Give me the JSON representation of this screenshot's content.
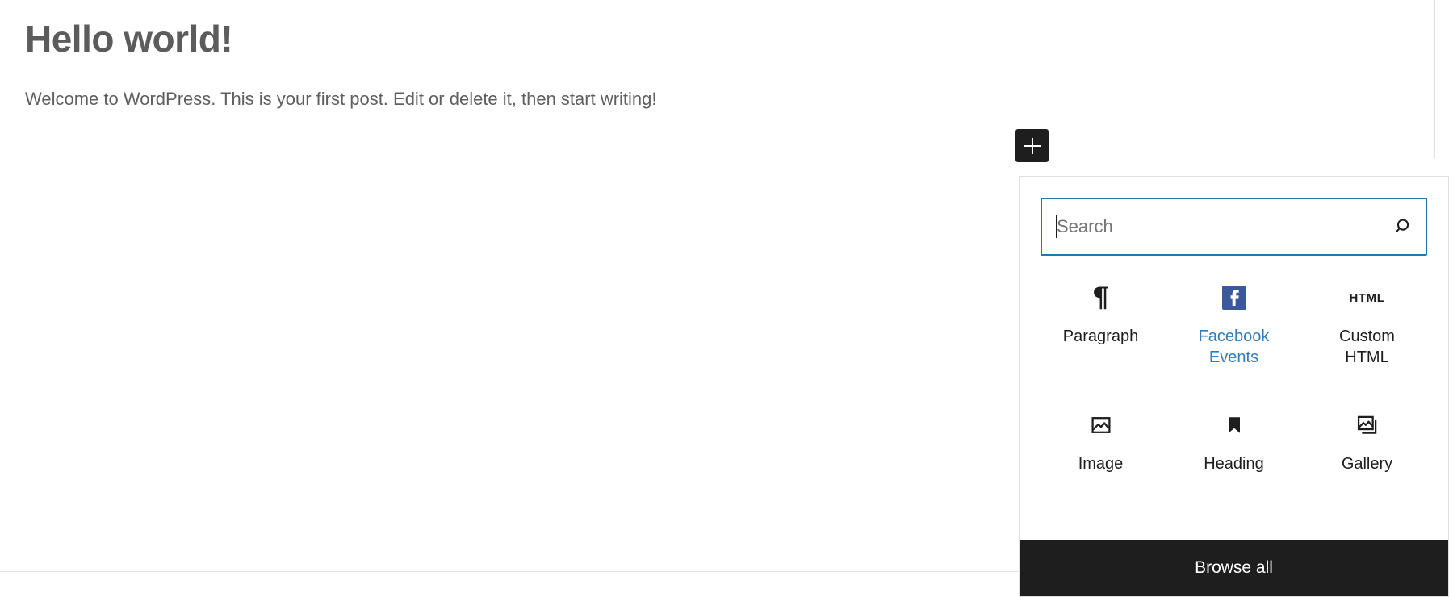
{
  "editor": {
    "post_title": "Hello world!",
    "post_paragraph": "Welcome to WordPress. This is your first post. Edit or delete it, then start writing!"
  },
  "inserter_toggle": {
    "label": "+",
    "icon": "plus-icon",
    "background_color": "#1e1e1e",
    "foreground_color": "#ffffff"
  },
  "inserter": {
    "search": {
      "value": "",
      "placeholder": "Search",
      "icon": "search-icon",
      "focused": true,
      "focus_border_color": "#1a7bb9"
    },
    "blocks": [
      {
        "label": "Paragraph",
        "icon": "paragraph-icon",
        "highlighted": false
      },
      {
        "label": "Facebook Events",
        "icon": "facebook-icon",
        "highlighted": true
      },
      {
        "label": "Custom HTML",
        "icon": "html-icon",
        "highlighted": false
      },
      {
        "label": "Image",
        "icon": "image-icon",
        "highlighted": false
      },
      {
        "label": "Heading",
        "icon": "heading-icon",
        "highlighted": false
      },
      {
        "label": "Gallery",
        "icon": "gallery-icon",
        "highlighted": false
      }
    ],
    "browse_all_label": "Browse all",
    "browse_all_background": "#1e1e1e",
    "highlight_color": "#2f7dbd",
    "facebook_brand_color": "#3b5998"
  }
}
